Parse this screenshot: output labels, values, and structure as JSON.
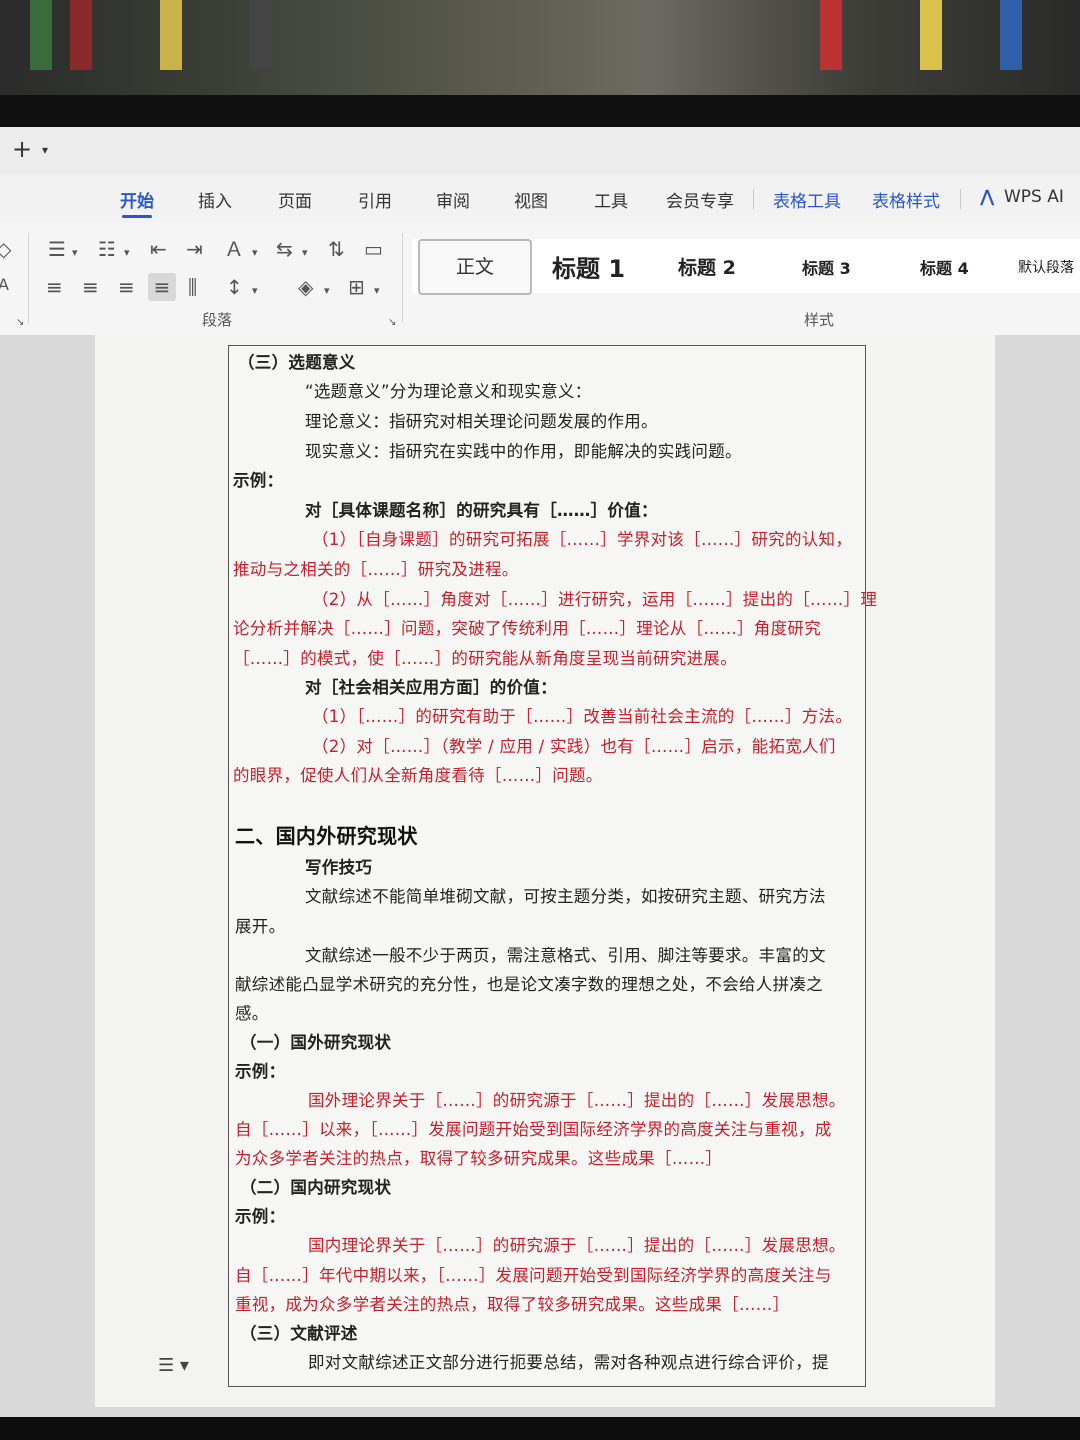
{
  "tabbar": {
    "new_tab": "+",
    "chevron": "⌄"
  },
  "menu": {
    "items": [
      "开始",
      "插入",
      "页面",
      "引用",
      "审阅",
      "视图",
      "工具",
      "会员专享",
      "表格工具",
      "表格样式",
      "WPS AI"
    ]
  },
  "toolbar": {
    "paragraph_group_label": "段落",
    "styles_group_label": "样式",
    "styles": [
      "正文",
      "标题 1",
      "标题 2",
      "标题 3",
      "标题 4",
      "默认段落"
    ]
  },
  "document": {
    "lines": [
      "（三）选题意义",
      "“选题意义”分为理论意义和现实意义：",
      "理论意义：指研究对相关理论问题发展的作用。",
      "现实意义：指研究在实践中的作用，即能解决的实践问题。",
      "示例：",
      "对［具体课题名称］的研究具有［……］价值：",
      "（1）［自身课题］的研究可拓展［……］学界对该［……］研究的认知，",
      "推动与之相关的［……］研究及进程。",
      "（2）从［……］角度对［……］进行研究，运用［……］提出的［……］理",
      "论分析并解决［……］问题，突破了传统利用［……］理论从［……］角度研究",
      "［……］的模式，使［……］的研究能从新角度呈现当前研究进展。",
      "对［社会相关应用方面］的价值：",
      "（1）［……］的研究有助于［……］改善当前社会主流的［……］方法。",
      "（2）对［……］（教学 / 应用 / 实践）也有［……］启示，能拓宽人们",
      "的眼界，促使人们从全新角度看待［……］问题。",
      "二、国内外研究现状",
      "写作技巧",
      "文献综述不能简单堆砌文献，可按主题分类，如按研究主题、研究方法",
      "展开。",
      "文献综述一般不少于两页，需注意格式、引用、脚注等要求。丰富的文",
      "献综述能凸显学术研究的充分性，也是论文凑字数的理想之处，不会给人拼凑之",
      "感。",
      "（一）国外研究现状",
      "示例：",
      "国外理论界关于［……］的研究源于［……］提出的［……］发展思想。",
      "自［……］以来，［……］发展问题开始受到国际经济学界的高度关注与重视，成",
      "为众多学者关注的热点，取得了较多研究成果。这些成果［……］",
      "（二）国内研究现状",
      "示例：",
      "国内理论界关于［……］的研究源于［……］提出的［……］发展思想。",
      "自［……］年代中期以来，［……］发展问题开始受到国际经济学界的高度关注与",
      "重视，成为众多学者关注的热点，取得了较多研究成果。这些成果［……］",
      "（三）文献评述",
      "即对文献综述正文部分进行扼要总结，需对各种观点进行综合评价，提"
    ]
  },
  "colors": {
    "accent": "#2a58c9",
    "example_text": "#c8202a"
  }
}
